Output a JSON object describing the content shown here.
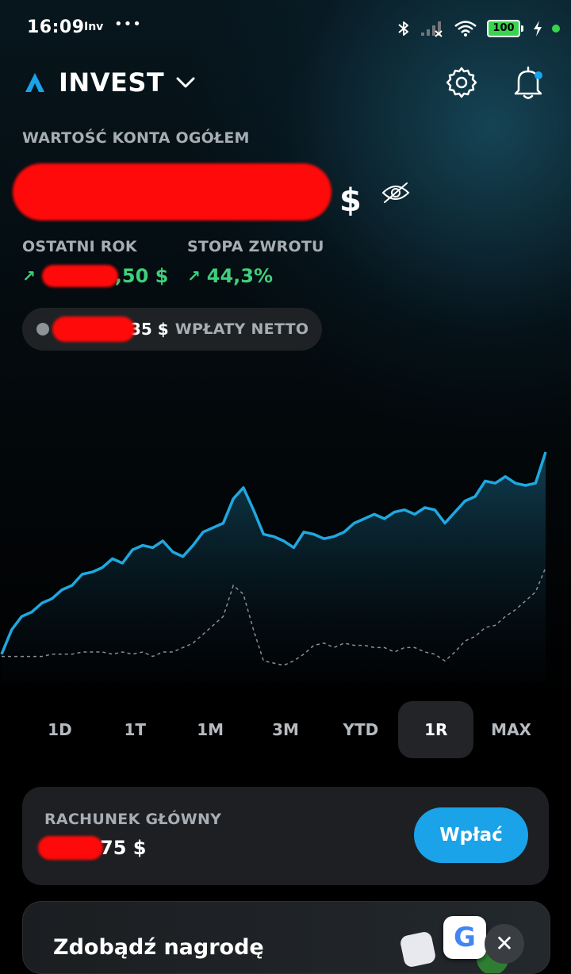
{
  "status_bar": {
    "time": "16:09",
    "app_label": "Inv",
    "more": "•••",
    "battery": "100"
  },
  "header": {
    "brand": "INVEST",
    "settings_icon": "gear-icon",
    "notifications_icon": "bell-icon"
  },
  "account_value": {
    "label": "WARTOŚĆ KONTA OGÓŁEM",
    "currency": "$",
    "visibility_icon": "eye-off-icon"
  },
  "stats": {
    "last_year": {
      "label": "OSTATNI ROK",
      "value_suffix": ",50 $"
    },
    "return_rate": {
      "label": "STOPA ZWROTU",
      "value": "44,3%"
    }
  },
  "net_deposits": {
    "value_suffix": "35 $",
    "label": "WPŁATY NETTO"
  },
  "chart_data": {
    "type": "line",
    "series": [
      {
        "values": [
          0.09,
          0.2,
          0.26,
          0.28,
          0.32,
          0.34,
          0.38,
          0.4,
          0.45,
          0.46,
          0.48,
          0.52,
          0.5,
          0.56,
          0.58,
          0.57,
          0.6,
          0.55,
          0.53,
          0.58,
          0.64,
          0.66,
          0.68,
          0.79,
          0.84,
          0.74,
          0.63,
          0.62,
          0.6,
          0.57,
          0.64,
          0.63,
          0.61,
          0.62,
          0.64,
          0.68,
          0.7,
          0.72,
          0.7,
          0.73,
          0.74,
          0.72,
          0.75,
          0.74,
          0.68,
          0.73,
          0.78,
          0.8,
          0.87,
          0.86,
          0.89,
          0.86,
          0.85,
          0.86,
          1.0
        ]
      },
      {
        "values": [
          0.08,
          0.08,
          0.08,
          0.08,
          0.08,
          0.09,
          0.09,
          0.09,
          0.1,
          0.1,
          0.1,
          0.09,
          0.1,
          0.09,
          0.1,
          0.08,
          0.1,
          0.1,
          0.12,
          0.14,
          0.18,
          0.22,
          0.26,
          0.4,
          0.36,
          0.2,
          0.06,
          0.05,
          0.04,
          0.06,
          0.09,
          0.13,
          0.14,
          0.12,
          0.14,
          0.13,
          0.13,
          0.12,
          0.12,
          0.1,
          0.12,
          0.12,
          0.1,
          0.09,
          0.06,
          0.1,
          0.15,
          0.17,
          0.21,
          0.22,
          0.26,
          0.29,
          0.33,
          0.37,
          0.48
        ]
      }
    ]
  },
  "periods": [
    "1D",
    "1T",
    "1M",
    "3M",
    "YTD",
    "1R",
    "MAX"
  ],
  "selected_period": "1R",
  "main_account": {
    "label": "RACHUNEK GŁÓWNY",
    "value_suffix": "75 $",
    "deposit_label": "Wpłać"
  },
  "promo": {
    "title": "Zdobądź nagrodę",
    "close": "✕",
    "g_letter": "G"
  },
  "colors": {
    "accent": "#1aa3e8",
    "positive": "#3ed07a",
    "redaction": "#ff0a0a"
  }
}
